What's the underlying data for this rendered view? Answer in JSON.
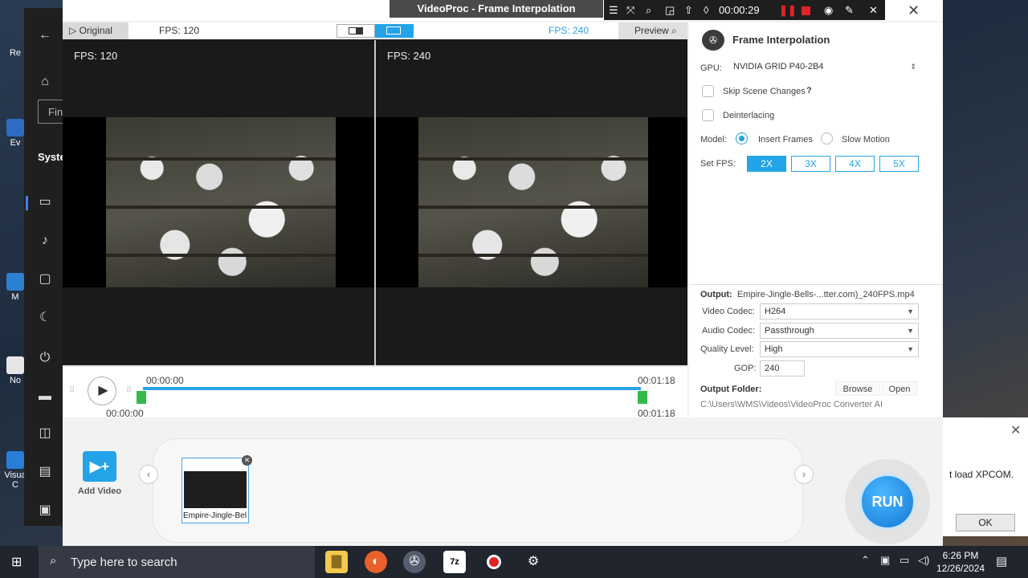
{
  "desktop": {
    "icons": [
      {
        "label": "Re"
      },
      {
        "label": "Ev"
      },
      {
        "label": "M"
      },
      {
        "label": "No"
      },
      {
        "label": "Visua"
      },
      {
        "label": "C"
      }
    ]
  },
  "settings_panel": {
    "find_text": "Fin",
    "section": "Syste"
  },
  "window": {
    "title": "VideoProc - Frame Interpolation"
  },
  "recorder": {
    "time": "00:00:29"
  },
  "viewer": {
    "original_tab": "Original",
    "fps_left_header": "FPS: 120",
    "fps_right_header": "FPS: 240",
    "preview_label": "Preview",
    "left_pane_label": "FPS: 120",
    "right_pane_label": "FPS: 240"
  },
  "timeline": {
    "start_top": "00:00:00",
    "end_top": "00:01:18",
    "start_bottom": "00:00:00",
    "end_bottom": "00:01:18"
  },
  "panel": {
    "title": "Frame Interpolation",
    "gpu_label": "GPU:",
    "gpu_value": "NVIDIA GRID P40-2B4",
    "skip_scene": "Skip Scene Changes",
    "help": "?",
    "deinterlacing": "Deinterlacing",
    "model_label": "Model:",
    "model_options": [
      "Insert Frames",
      "Slow Motion"
    ],
    "set_fps_label": "Set FPS:",
    "fps_options": [
      "2X",
      "3X",
      "4X",
      "5X"
    ],
    "output_label": "Output:",
    "output_file": "Empire-Jingle-Bells-...tter.com)_240FPS.mp4",
    "video_codec_label": "Video Codec:",
    "video_codec": "H264",
    "audio_codec_label": "Audio Codec:",
    "audio_codec": "Passthrough",
    "quality_label": "Quality Level:",
    "quality": "High",
    "gop_label": "GOP:",
    "gop": "240",
    "output_folder_label": "Output Folder:",
    "browse": "Browse",
    "open": "Open",
    "folder_path": "C:\\Users\\WMS\\Videos\\VideoProc Converter AI"
  },
  "bottom": {
    "add_video": "Add Video",
    "clip_name": "Empire-Jingle-Bel",
    "run": "RUN"
  },
  "dialog": {
    "message": "t load XPCOM.",
    "ok": "OK"
  },
  "taskbar": {
    "search_placeholder": "Type here to search",
    "time": "6:26 PM",
    "date": "12/26/2024"
  },
  "colors": {
    "accent": "#23a3e8",
    "handle": "#35b84a",
    "record": "#e02424"
  }
}
